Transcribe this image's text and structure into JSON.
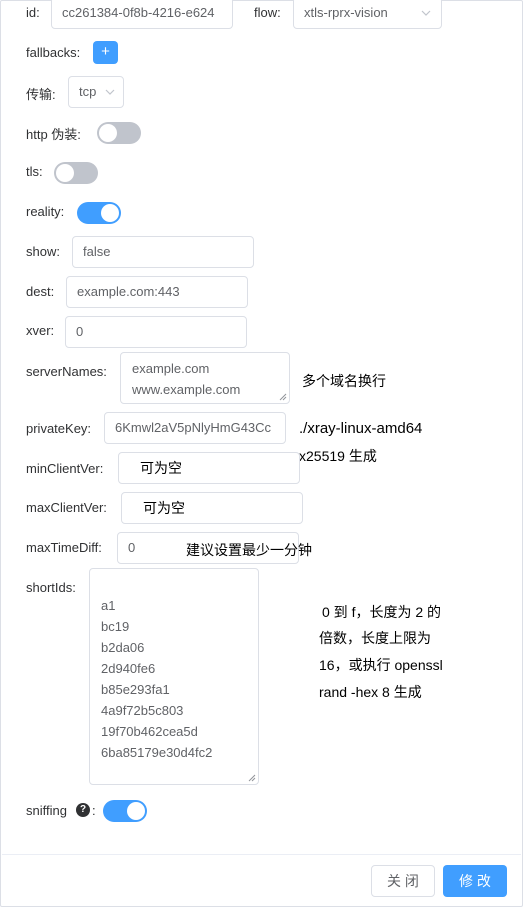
{
  "form": {
    "id_label": "id:",
    "id_value": "cc261384-0f8b-4216-e624",
    "flow_label": "flow:",
    "flow_value": "xtls-rprx-vision",
    "fallbacks_label": "fallbacks:",
    "fallbacks_add": "+",
    "transport_label": "传输:",
    "transport_value": "tcp",
    "http_label": "http 伪装:",
    "http_on": false,
    "tls_label": "tls:",
    "tls_on": false,
    "reality_label": "reality:",
    "reality_on": true,
    "show_label": "show:",
    "show_value": "false",
    "dest_label": "dest:",
    "dest_value": "example.com:443",
    "xver_label": "xver:",
    "xver_value": "0",
    "servernames_label": "serverNames:",
    "servernames_lines": [
      "example.com",
      "www.example.com"
    ],
    "servernames_note": "多个域名换行",
    "privatekey_label": "privateKey:",
    "privatekey_value": "6Kmwl2aV5pNlyHmG43Cc",
    "privatekey_note_lines": [
      "./xray-linux-amd64",
      "x25519 生成"
    ],
    "minclient_label": "minClientVer:",
    "minclient_value": "可为空",
    "maxclient_label": "maxClientVer:",
    "maxclient_value": "可为空",
    "maxtimediff_label": "maxTimeDiff:",
    "maxtimediff_value": "0",
    "maxtimediff_note": "建议设置最少一分钟",
    "shortids_label": "shortIds:",
    "shortids_lines": [
      "a1",
      "bc19",
      "b2da06",
      "2d940fe6",
      "b85e293fa1",
      "4a9f72b5c803",
      "19f70b462cea5d",
      "6ba85179e30d4fc2"
    ],
    "shortids_note_lines": [
      "0 到 f，长度为 2 的",
      "倍数，长度上限为",
      "16，或执行 openssl",
      "rand -hex 8 生成"
    ],
    "sniffing_label": "sniffing",
    "sniffing_colon": ":",
    "sniffing_help": "?",
    "sniffing_on": true
  },
  "footer": {
    "close_label": "关 闭",
    "modify_label": "修 改"
  },
  "colors": {
    "accent": "#409eff",
    "switch_off": "#c0c4cc"
  }
}
